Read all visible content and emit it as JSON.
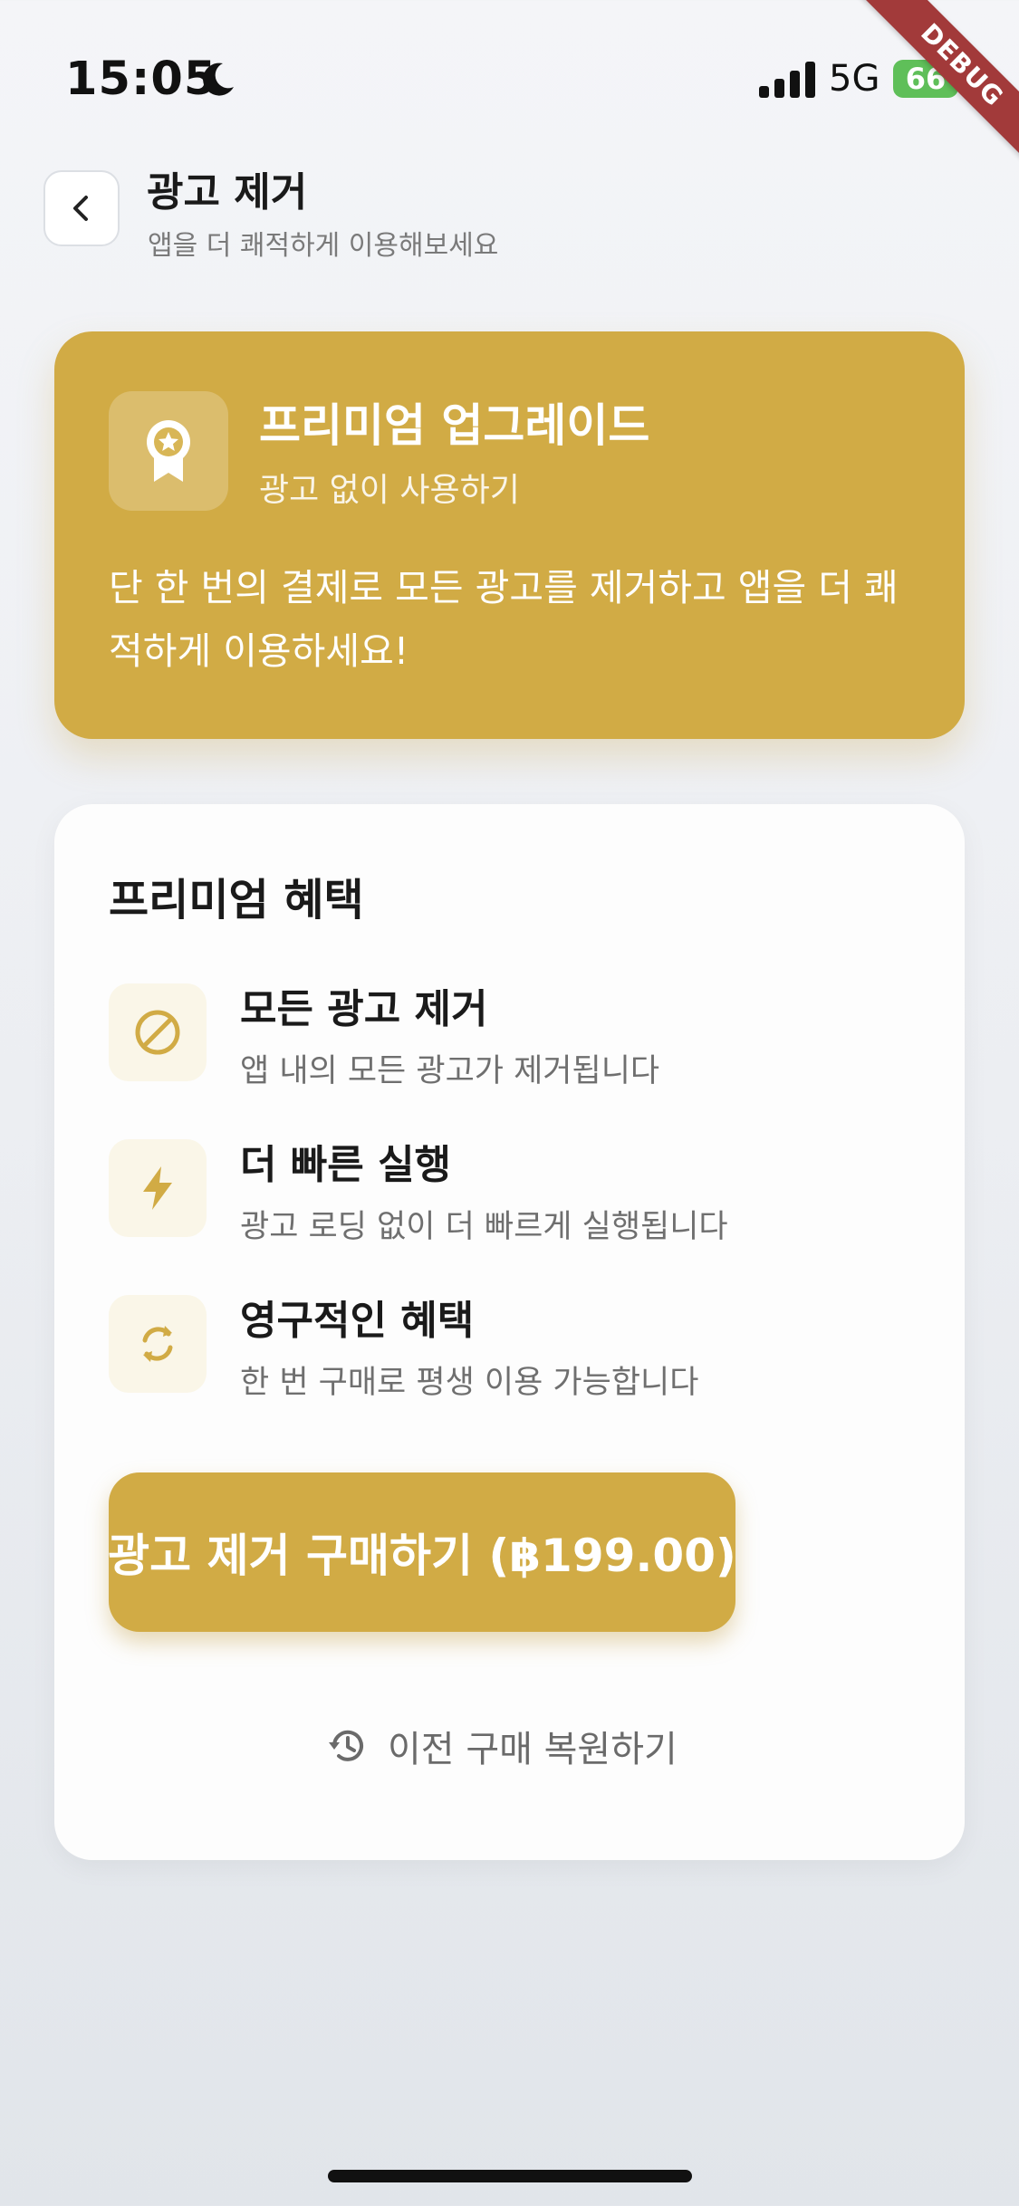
{
  "status_bar": {
    "time": "15:05",
    "network": "5G",
    "battery": "66",
    "debug_banner": "DEBUG"
  },
  "header": {
    "title": "광고 제거",
    "subtitle": "앱을 더 쾌적하게 이용해보세요"
  },
  "premium_card": {
    "title": "프리미엄 업그레이드",
    "subtitle": "광고 없이 사용하기",
    "description": "단 한 번의 결제로 모든 광고를 제거하고 앱을 더 쾌적하게 이용하세요!",
    "color": "#D1AB45"
  },
  "benefits": {
    "title": "프리미엄 혜택",
    "items": [
      {
        "icon": "block-icon",
        "title": "모든 광고 제거",
        "description": "앱 내의 모든 광고가 제거됩니다"
      },
      {
        "icon": "bolt-icon",
        "title": "더 빠른 실행",
        "description": "광고 로딩 없이 더 빠르게 실행됩니다"
      },
      {
        "icon": "refresh-icon",
        "title": "영구적인 혜택",
        "description": "한 번 구매로 평생 이용 가능합니다"
      }
    ]
  },
  "purchase_button": {
    "label": "광고 제거 구매하기 (฿199.00)"
  },
  "restore": {
    "label": "이전 구매 복원하기"
  },
  "colors": {
    "accent": "#D1AB45",
    "icon_background": "#FAF6E8",
    "battery": "#5FBF59",
    "debug_ribbon": "#A23A3A"
  }
}
